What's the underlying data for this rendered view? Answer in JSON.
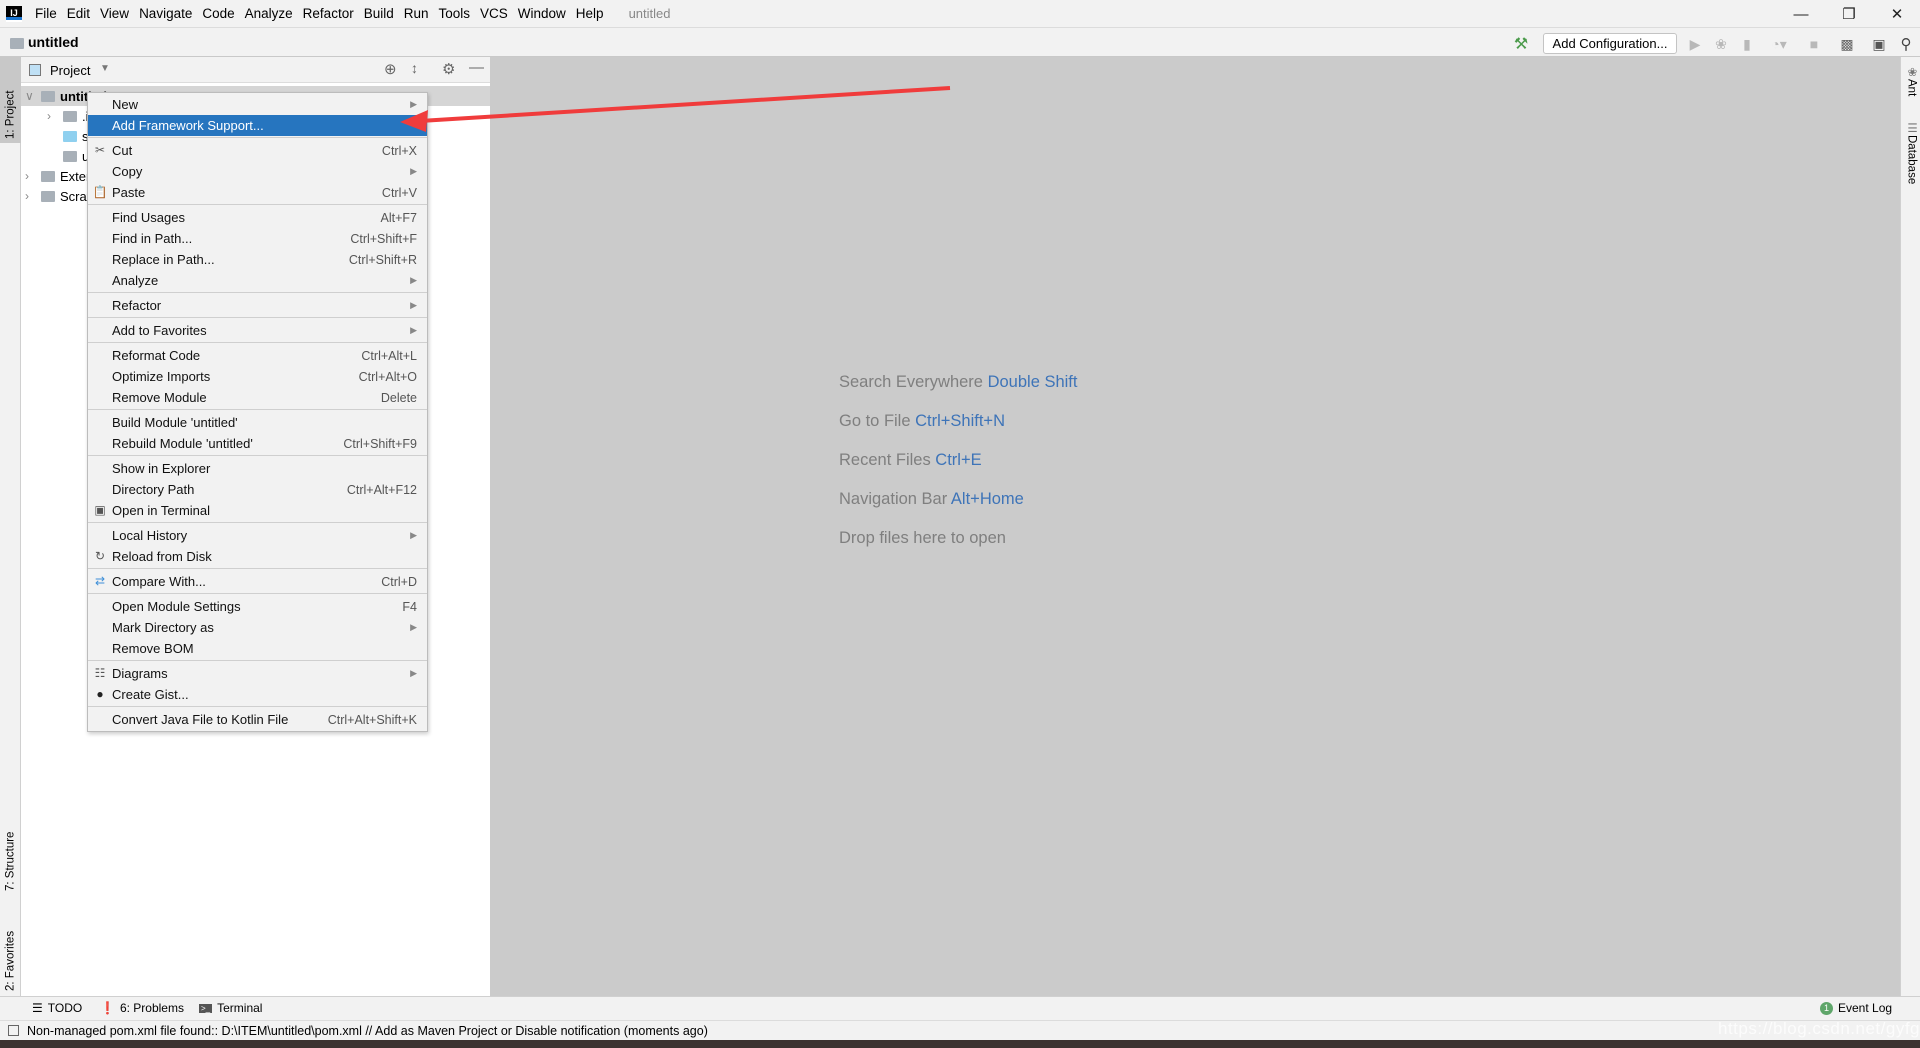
{
  "app": {
    "window_title": "untitled",
    "project_name": "untitled"
  },
  "menubar": [
    "File",
    "Edit",
    "View",
    "Navigate",
    "Code",
    "Analyze",
    "Refactor",
    "Build",
    "Run",
    "Tools",
    "VCS",
    "Window",
    "Help"
  ],
  "toolbar": {
    "add_configuration": "Add Configuration..."
  },
  "left_stripe": {
    "project": "1: Project",
    "structure": "7: Structure",
    "favorites": "2: Favorites"
  },
  "right_stripe": {
    "ant": "Ant",
    "database": "Database"
  },
  "project_panel": {
    "title": "Project",
    "tree": [
      {
        "label": "untitled",
        "bold": true,
        "level": 0
      },
      {
        "label": ".idea",
        "level": 1
      },
      {
        "label": "src",
        "level": 1
      },
      {
        "label": "untitled.iml",
        "level": 1
      },
      {
        "label": "External Libraries",
        "level": 0
      },
      {
        "label": "Scratches and Consoles",
        "level": 0
      }
    ]
  },
  "context_menu": [
    [
      {
        "label": "New",
        "submenu": true
      },
      {
        "label": "Add Framework Support...",
        "selected": true
      }
    ],
    [
      {
        "label": "Cut",
        "shortcut": "Ctrl+X",
        "icon": "scissors-icon"
      },
      {
        "label": "Copy",
        "submenu": true
      },
      {
        "label": "Paste",
        "shortcut": "Ctrl+V",
        "icon": "clipboard-icon"
      }
    ],
    [
      {
        "label": "Find Usages",
        "shortcut": "Alt+F7"
      },
      {
        "label": "Find in Path...",
        "shortcut": "Ctrl+Shift+F"
      },
      {
        "label": "Replace in Path...",
        "shortcut": "Ctrl+Shift+R"
      },
      {
        "label": "Analyze",
        "submenu": true
      }
    ],
    [
      {
        "label": "Refactor",
        "submenu": true
      }
    ],
    [
      {
        "label": "Add to Favorites",
        "submenu": true
      }
    ],
    [
      {
        "label": "Reformat Code",
        "shortcut": "Ctrl+Alt+L"
      },
      {
        "label": "Optimize Imports",
        "shortcut": "Ctrl+Alt+O"
      },
      {
        "label": "Remove Module",
        "shortcut": "Delete"
      }
    ],
    [
      {
        "label": "Build Module 'untitled'"
      },
      {
        "label": "Rebuild Module 'untitled'",
        "shortcut": "Ctrl+Shift+F9"
      }
    ],
    [
      {
        "label": "Show in Explorer"
      },
      {
        "label": "Directory Path",
        "shortcut": "Ctrl+Alt+F12"
      },
      {
        "label": "Open in Terminal",
        "icon": "terminal-icon"
      }
    ],
    [
      {
        "label": "Local History",
        "submenu": true
      },
      {
        "label": "Reload from Disk",
        "icon": "reload-icon"
      }
    ],
    [
      {
        "label": "Compare With...",
        "shortcut": "Ctrl+D",
        "icon": "compare-icon"
      }
    ],
    [
      {
        "label": "Open Module Settings",
        "shortcut": "F4"
      },
      {
        "label": "Mark Directory as",
        "submenu": true
      },
      {
        "label": "Remove BOM"
      }
    ],
    [
      {
        "label": "Diagrams",
        "submenu": true,
        "icon": "diagram-icon"
      },
      {
        "label": "Create Gist...",
        "icon": "github-icon"
      }
    ],
    [
      {
        "label": "Convert Java File to Kotlin File",
        "shortcut": "Ctrl+Alt+Shift+K"
      }
    ]
  ],
  "editor_hints": [
    {
      "text": "Search Everywhere",
      "key": "Double Shift"
    },
    {
      "text": "Go to File",
      "key": "Ctrl+Shift+N"
    },
    {
      "text": "Recent Files",
      "key": "Ctrl+E"
    },
    {
      "text": "Navigation Bar",
      "key": "Alt+Home"
    },
    {
      "text": "Drop files here to open",
      "key": ""
    }
  ],
  "bottom_tabs": {
    "todo": "TODO",
    "problems": "6: Problems",
    "terminal": "Terminal",
    "event_log": "Event Log",
    "event_count": "1"
  },
  "status": {
    "message": "Non-managed pom.xml file found:: D:\\ITEM\\untitled\\pom.xml // Add as Maven Project or Disable notification (moments ago)"
  },
  "watermark": "https://blog.csdn.net/gyfghh",
  "colors": {
    "selection": "#2675bf",
    "shortcut_blue": "#3e74b8",
    "editor_bg": "#cbcbcb",
    "arrow": "#f03c3c"
  }
}
